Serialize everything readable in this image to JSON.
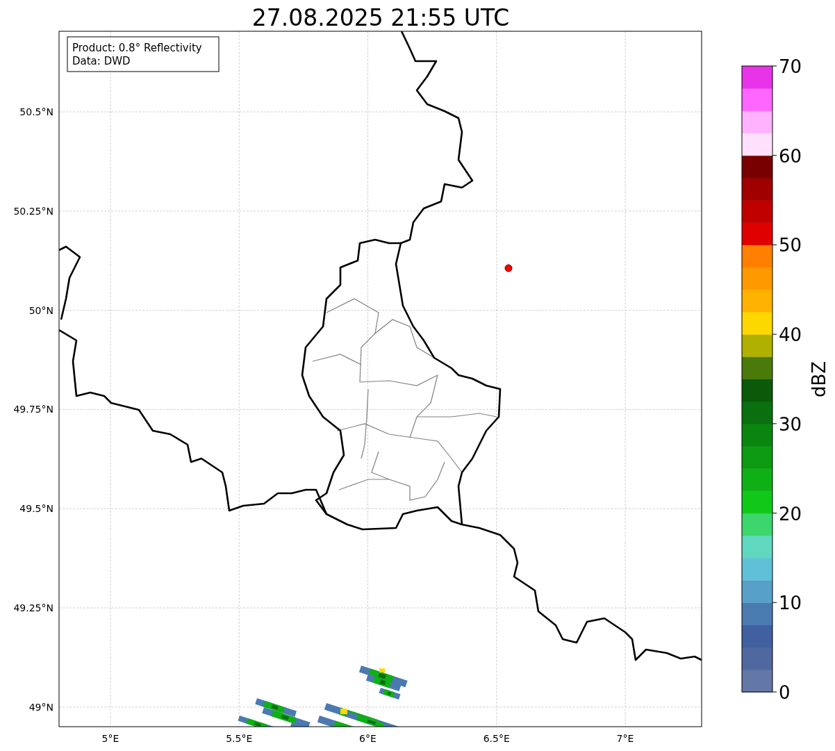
{
  "title": "27.08.2025 21:55 UTC",
  "info_box": {
    "lines": [
      "Product: 0.8° Reflectivity",
      "Data: DWD"
    ]
  },
  "map": {
    "lat_labels": [
      "50.5°N",
      "50.25°N",
      "50°N",
      "49.75°N",
      "49.5°N",
      "49.25°N",
      "49°N"
    ],
    "lon_labels": [
      "5°E",
      "5.5°E",
      "6°E",
      "6.5°E",
      "7°E"
    ]
  },
  "colorbar": {
    "label": "dBZ",
    "tick_labels": [
      "70",
      "60",
      "50",
      "40",
      "30",
      "20",
      "10",
      "0"
    ],
    "bins": [
      {
        "color": "#6478a8"
      },
      {
        "color": "#5068a0"
      },
      {
        "color": "#4060a0"
      },
      {
        "color": "#4a7ab0"
      },
      {
        "color": "#58a0c8"
      },
      {
        "color": "#60c0d8"
      },
      {
        "color": "#60d8c0"
      },
      {
        "color": "#3dd66c"
      },
      {
        "color": "#10c818"
      },
      {
        "color": "#0fb015"
      },
      {
        "color": "#0c9a12"
      },
      {
        "color": "#0a8510"
      },
      {
        "color": "#0a700f"
      },
      {
        "color": "#0a5a0a"
      },
      {
        "color": "#4a7a0a"
      },
      {
        "color": "#b0b000"
      },
      {
        "color": "#ffd800"
      },
      {
        "color": "#ffb300"
      },
      {
        "color": "#ff9900"
      },
      {
        "color": "#ff7f00"
      },
      {
        "color": "#e00000"
      },
      {
        "color": "#c00000"
      },
      {
        "color": "#a00000"
      },
      {
        "color": "#780000"
      },
      {
        "color": "#ffe0ff"
      },
      {
        "color": "#ffb3ff"
      },
      {
        "color": "#ff66ff"
      },
      {
        "color": "#e833e8"
      }
    ]
  }
}
